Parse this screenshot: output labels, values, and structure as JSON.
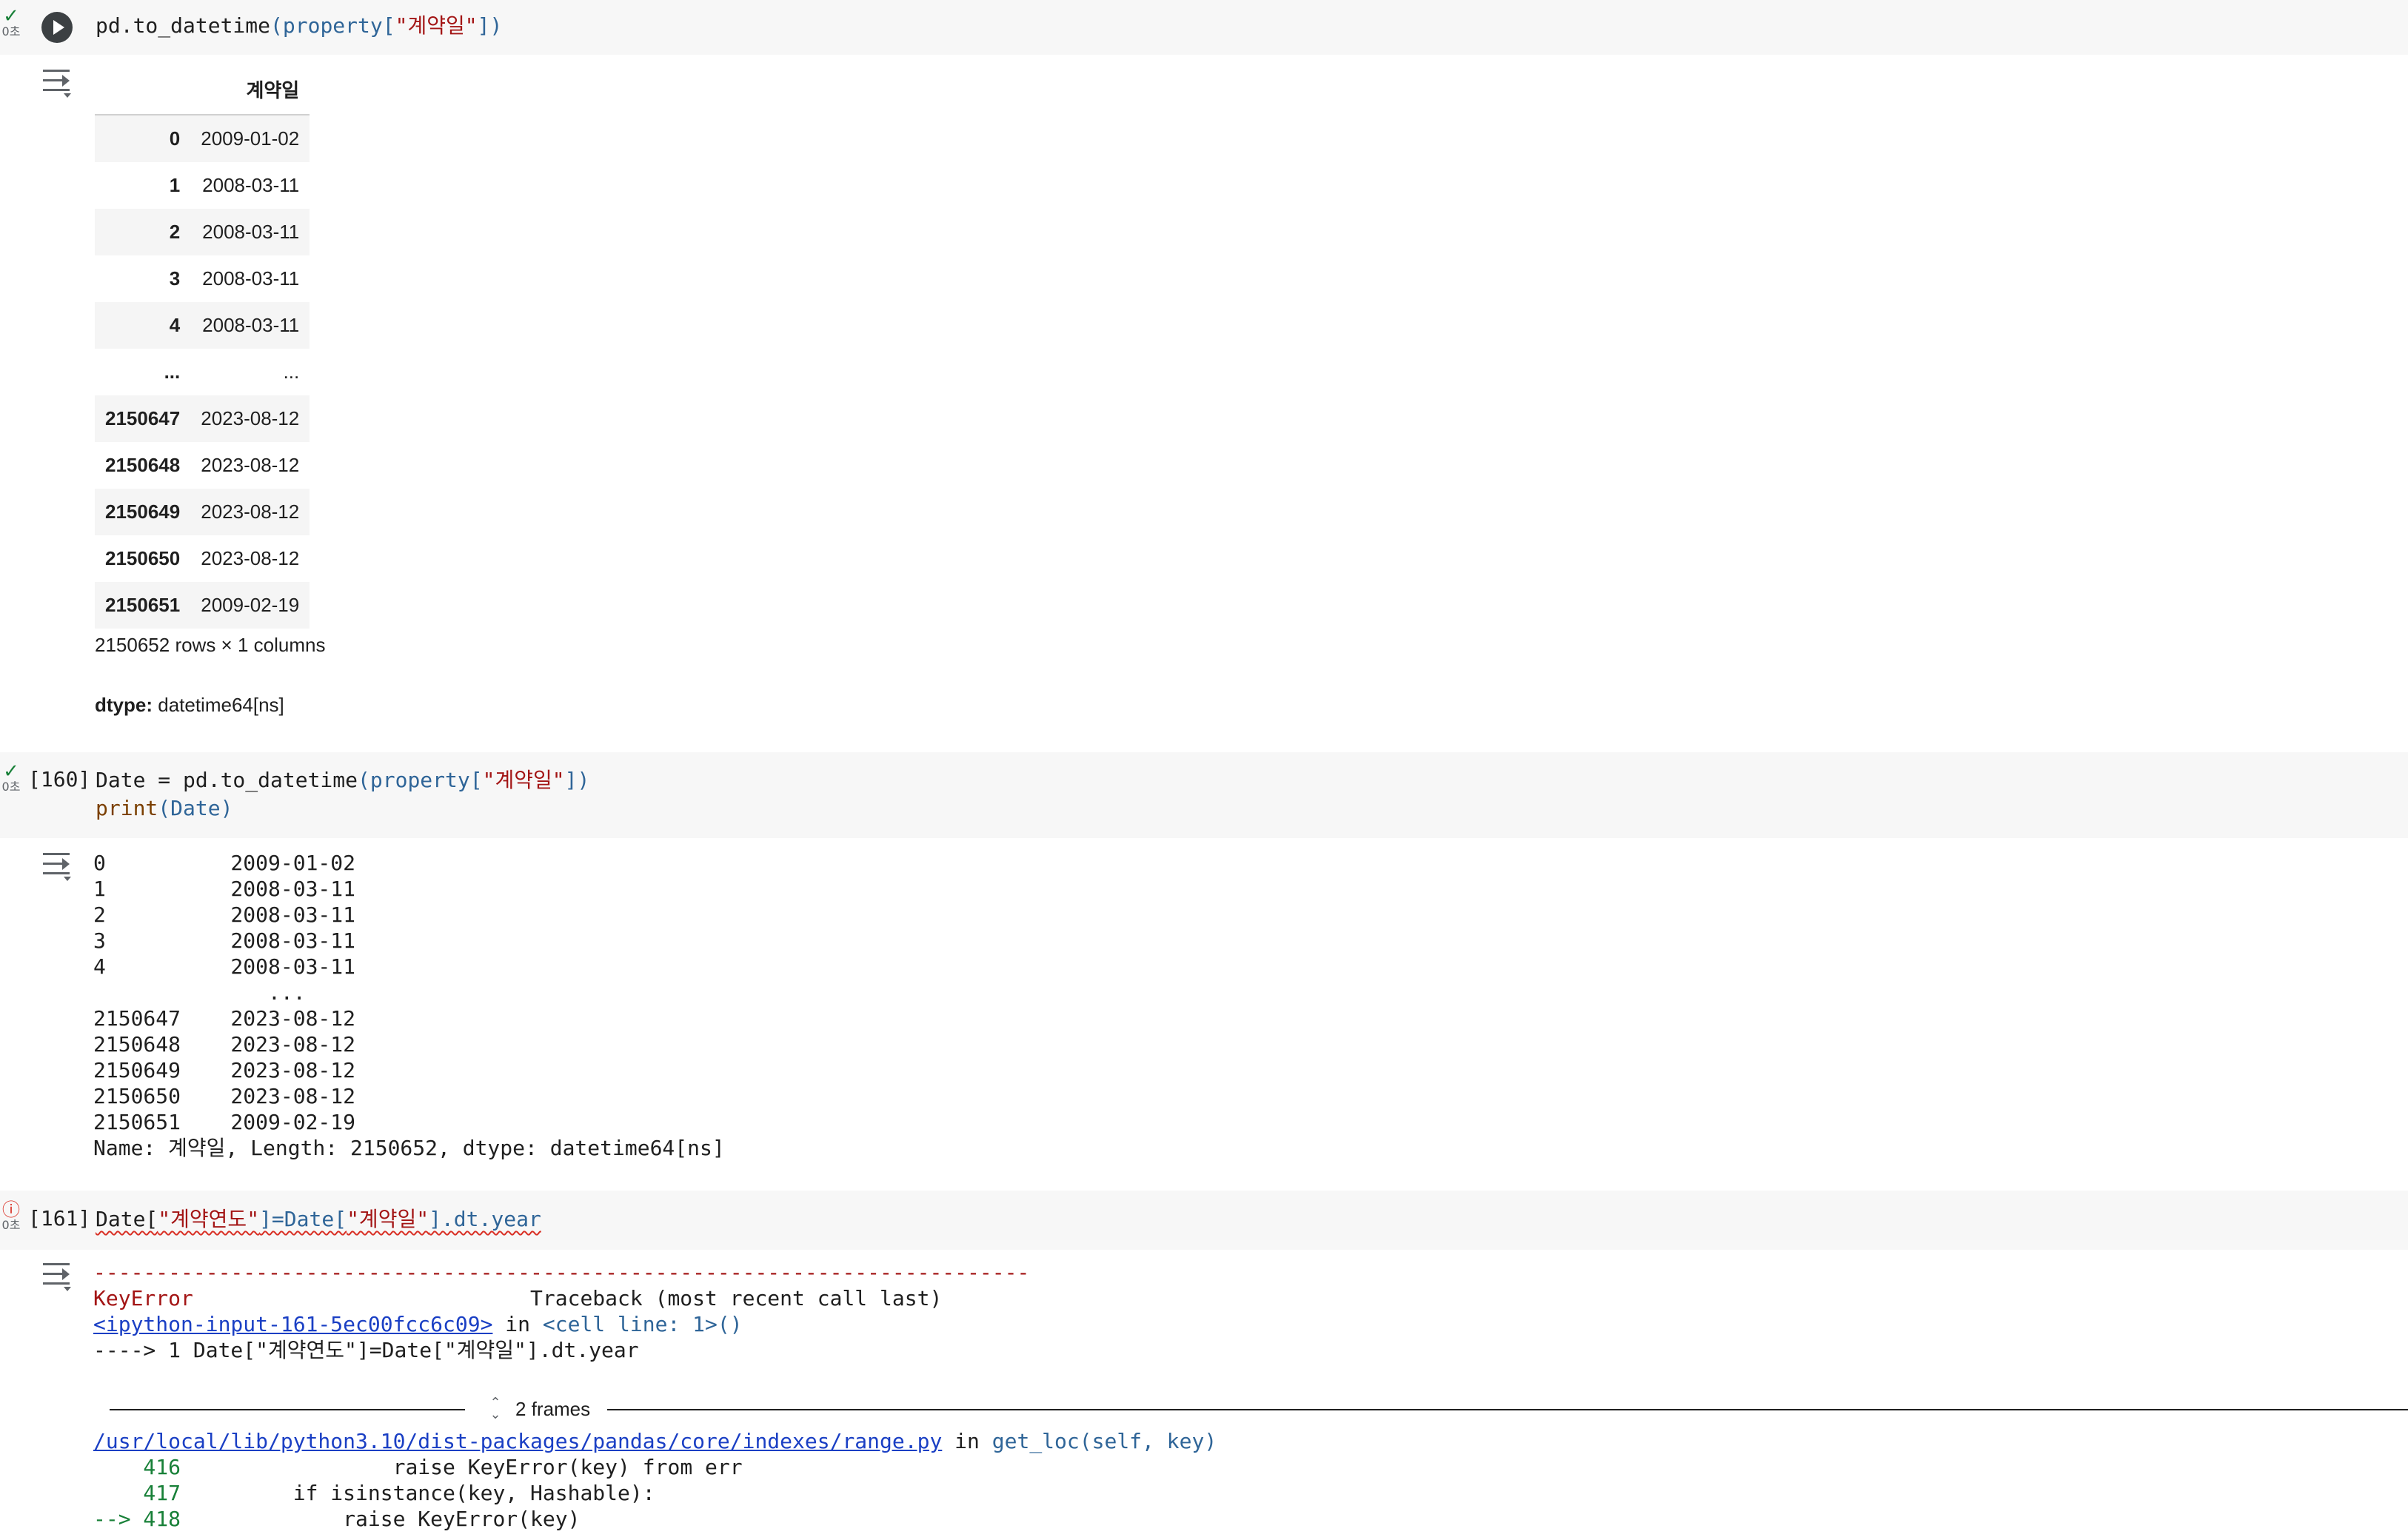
{
  "cell1": {
    "status_time": "0초",
    "code_prefix": "pd.to_datetime",
    "code_paren_open": "(",
    "code_var": "property",
    "code_bracket_open": "[",
    "code_string": "\"계약일\"",
    "code_bracket_close": "]",
    "code_paren_close": ")",
    "table": {
      "column_header": "계약일",
      "rows": [
        {
          "index": "0",
          "value": "2009-01-02"
        },
        {
          "index": "1",
          "value": "2008-03-11"
        },
        {
          "index": "2",
          "value": "2008-03-11"
        },
        {
          "index": "3",
          "value": "2008-03-11"
        },
        {
          "index": "4",
          "value": "2008-03-11"
        },
        {
          "index": "...",
          "value": "..."
        },
        {
          "index": "2150647",
          "value": "2023-08-12"
        },
        {
          "index": "2150648",
          "value": "2023-08-12"
        },
        {
          "index": "2150649",
          "value": "2023-08-12"
        },
        {
          "index": "2150650",
          "value": "2023-08-12"
        },
        {
          "index": "2150651",
          "value": "2009-02-19"
        }
      ]
    },
    "shape": "2150652 rows × 1 columns",
    "dtype_label": "dtype:",
    "dtype_value": "datetime64[ns]"
  },
  "cell2": {
    "status_time": "0초",
    "exec_count": "[160]",
    "line1_a": "Date = pd.to_datetime",
    "line1_b": "(property[",
    "line1_c": "\"계약일\"",
    "line1_d": "])",
    "line2_a": "print",
    "line2_b": "(Date)",
    "output_lines": [
      "0          2009-01-02",
      "1          2008-03-11",
      "2          2008-03-11",
      "3          2008-03-11",
      "4          2008-03-11",
      "              ...",
      "2150647    2023-08-12",
      "2150648    2023-08-12",
      "2150649    2023-08-12",
      "2150650    2023-08-12",
      "2150651    2009-02-19",
      "Name: 계약일, Length: 2150652, dtype: datetime64[ns]"
    ]
  },
  "cell3": {
    "status_time": "0초",
    "exec_count": "[161]",
    "code_a": "Date[",
    "code_b": "\"계약연도\"",
    "code_c": "]=Date[",
    "code_d": "\"계약일\"",
    "code_e": "].dt.year",
    "tb_dashes": "---------------------------------------------------------------------------",
    "tb_error_name": "KeyError",
    "tb_header_rest": "                           Traceback (most recent call last)",
    "tb_input_link": "<ipython-input-161-5ec00fcc6c09>",
    "tb_in": " in ",
    "tb_cell_line": "<cell line: 1>()",
    "tb_arrow_line": "----> 1 Date[\"계약연도\"]=Date[\"계약일\"].dt.year",
    "frames_label": "2 frames",
    "tb_file_link": "/usr/local/lib/python3.10/dist-packages/pandas/core/indexes/range.py",
    "tb_in2": " in ",
    "tb_func": "get_loc(self, key)",
    "tb_line416_no": "    416",
    "tb_line416_code": "                 raise KeyError(key) from err",
    "tb_line417_no": "    417",
    "tb_line417_code": "         if isinstance(key, Hashable):",
    "tb_line418_no": "--> 418",
    "tb_line418_code": "             raise KeyError(key)"
  }
}
